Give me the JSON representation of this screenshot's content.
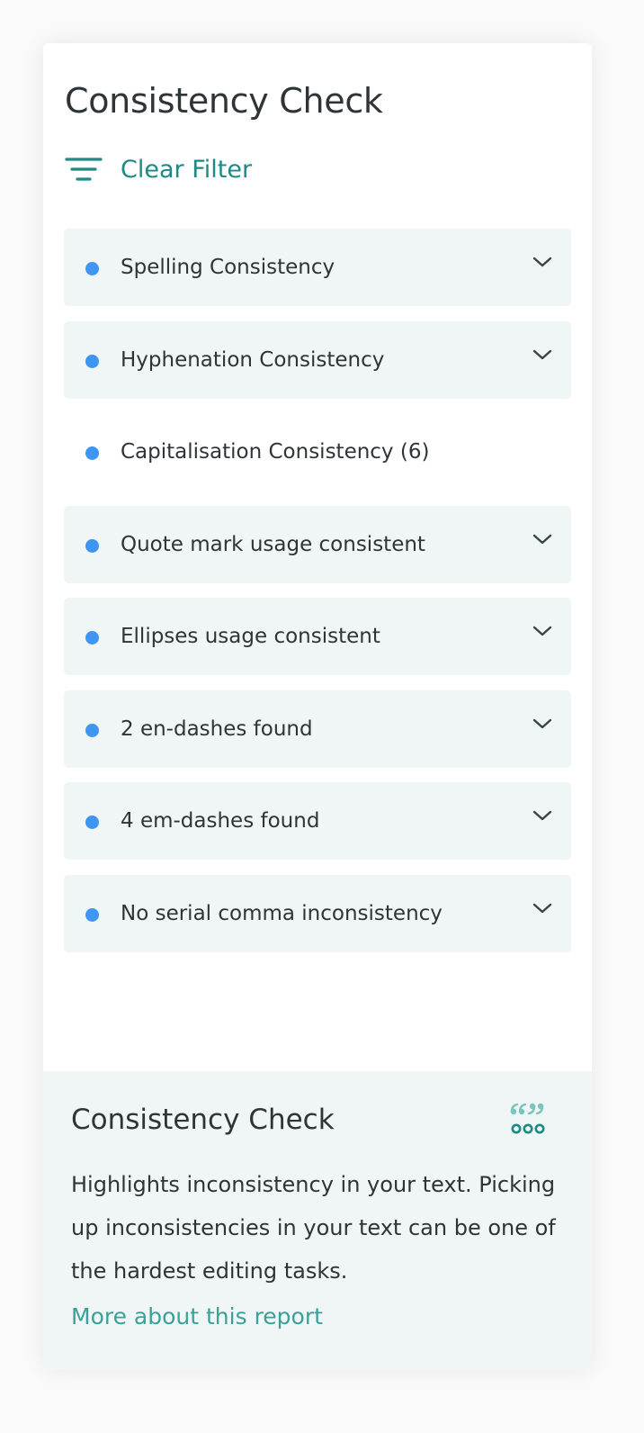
{
  "panel": {
    "title": "Consistency Check",
    "filter": {
      "label": "Clear Filter",
      "icon": "filter-lines-icon"
    },
    "checks": [
      {
        "label": "Spelling Consistency",
        "expandable": true
      },
      {
        "label": "Hyphenation Consistency",
        "expandable": true
      },
      {
        "label": "Capitalisation Consistency (6)",
        "expandable": false
      },
      {
        "label": "Quote mark usage consistent",
        "expandable": true
      },
      {
        "label": "Ellipses usage consistent",
        "expandable": true
      },
      {
        "label": "2 en-dashes found",
        "expandable": true
      },
      {
        "label": "4 em-dashes found",
        "expandable": true
      },
      {
        "label": "No serial comma inconsistency",
        "expandable": true
      }
    ]
  },
  "info": {
    "title": "Consistency Check",
    "icon": "quote-marks-icon",
    "description": "Highlights inconsistency in your text. Picking up inconsistencies in your text can be one of the hardest editing tasks.",
    "link": "More about this report"
  },
  "colors": {
    "accent": "#1e8a84",
    "link": "#3aa19a",
    "dot": "#3f95f2",
    "item_bg": "#eff6f5",
    "text": "#2e3438"
  }
}
